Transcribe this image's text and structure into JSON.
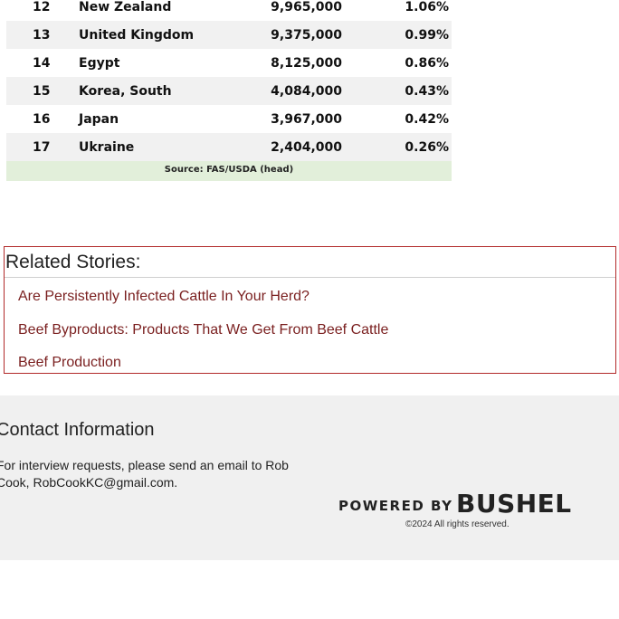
{
  "table": {
    "rows": [
      {
        "rank": "12",
        "country": "New Zealand",
        "head": "9,965,000",
        "share": "1.06%"
      },
      {
        "rank": "13",
        "country": "United Kingdom",
        "head": "9,375,000",
        "share": "0.99%"
      },
      {
        "rank": "14",
        "country": "Egypt",
        "head": "8,125,000",
        "share": "0.86%"
      },
      {
        "rank": "15",
        "country": "Korea, South",
        "head": "4,084,000",
        "share": "0.43%"
      },
      {
        "rank": "16",
        "country": "Japan",
        "head": "3,967,000",
        "share": "0.42%"
      },
      {
        "rank": "17",
        "country": "Ukraine",
        "head": "2,404,000",
        "share": "0.26%"
      }
    ],
    "source": "Source: FAS/USDA (head)",
    "shade_color": "#f1f1f1",
    "source_bg": "#e2efda"
  },
  "related": {
    "title": "Related Stories:",
    "links": [
      "Are Persistently Infected Cattle In Your Herd?",
      "Beef Byproducts: Products That We Get From Beef Cattle",
      "Beef Production"
    ],
    "border_color": "#b22a2a",
    "link_color": "#7a1f1f"
  },
  "footer": {
    "heading": "Contact Information",
    "text": "For interview requests, please send an email to Rob Cook, RobCookKC@gmail.com.",
    "powered_by_prefix": "POWERED BY",
    "powered_by_brand": "BUSHEL",
    "copyright": "©2024 All rights reserved.",
    "background": "#f0f0f0"
  }
}
